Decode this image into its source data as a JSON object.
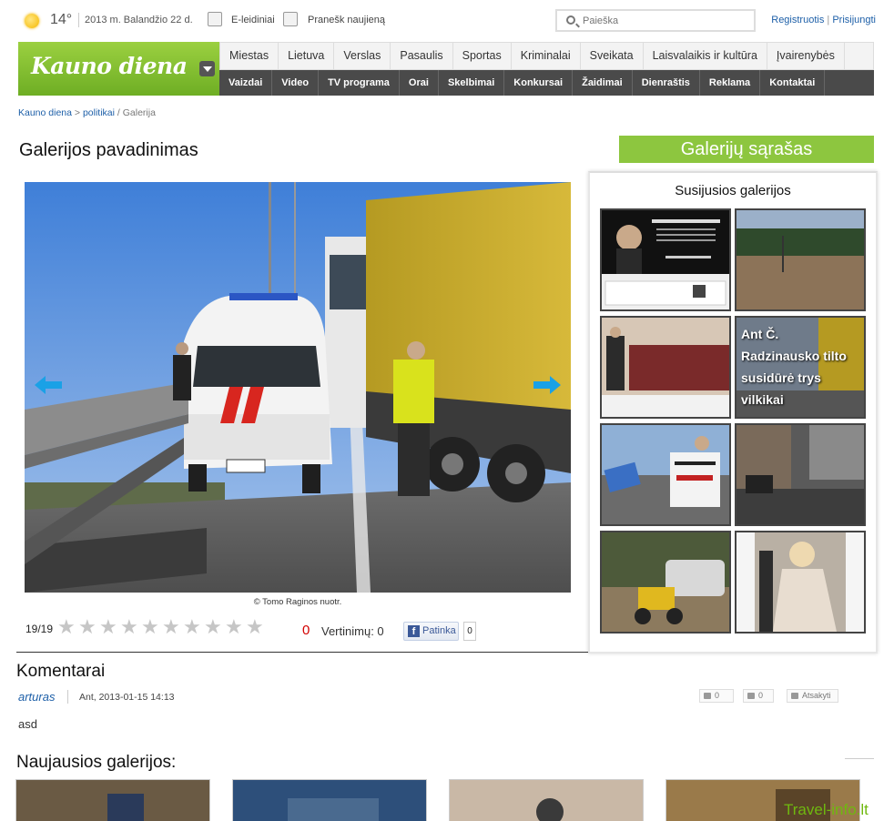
{
  "topbar": {
    "temperature": "14°",
    "date": "2013 m. Balandžio 22 d.",
    "e_editions": "E-leidiniai",
    "report_news": "Pranešk naujieną",
    "search_placeholder": "Paieška",
    "register": "Registruotis",
    "auth_sep": "|",
    "login": "Prisijungti"
  },
  "header": {
    "logo": "Kauno diena",
    "primary_nav": [
      "Miestas",
      "Lietuva",
      "Verslas",
      "Pasaulis",
      "Sportas",
      "Kriminalai",
      "Sveikata",
      "Laisvalaikis ir kultūra",
      "Įvairenybės"
    ],
    "secondary_nav": [
      "Vaizdai",
      "Video",
      "TV programa",
      "Orai",
      "Skelbimai",
      "Konkursai",
      "Žaidimai",
      "Dienraštis",
      "Reklama",
      "Kontaktai"
    ]
  },
  "breadcrumb": {
    "home": "Kauno diena",
    "sep1": " > ",
    "section": "politikai",
    "sep2": " / ",
    "current": "Galerija"
  },
  "gallery": {
    "title": "Galerijos pavadinimas",
    "photo_credit": "© Tomo Raginos nuotr.",
    "counter": "19/19",
    "rating_zero": "0",
    "votes": "Vertinimų: 0",
    "like_label": "Patinka",
    "like_count": "0",
    "stars_count": 10
  },
  "sidebar": {
    "gallery_list_title": "Galerijų sąrašas",
    "related_title": "Susijusios galerijos",
    "thumbs": [
      {
        "caption": ""
      },
      {
        "caption": ""
      },
      {
        "caption": ""
      },
      {
        "caption": "Ant Č. Radzinausko tilto susidūrė trys vilkikai"
      },
      {
        "caption": ""
      },
      {
        "caption": ""
      },
      {
        "caption": ""
      },
      {
        "caption": ""
      }
    ]
  },
  "comments": {
    "title": "Komentarai",
    "items": [
      {
        "author": "arturas",
        "date": "Ant, 2013-01-15 14:13",
        "up": "0",
        "down": "0",
        "reply": "Atsakyti",
        "text": "asd"
      }
    ]
  },
  "latest": {
    "title": "Naujausios galerijos:"
  },
  "watermark": "Travel-info.lt",
  "colors": {
    "brand_green": "#8dc63f",
    "nav_dark": "#4a4a4a",
    "link_blue": "#1d5fa8",
    "zero_red": "#d30000"
  }
}
